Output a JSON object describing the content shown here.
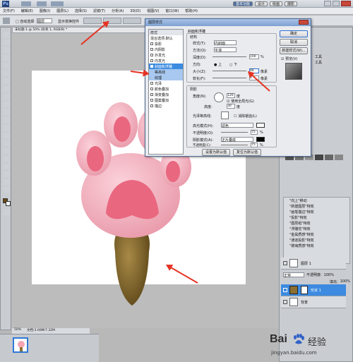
{
  "app": {
    "logo": "Ps",
    "right_buttons": [
      "基本功能",
      "设计",
      "绘画",
      "摄影"
    ]
  },
  "menu": [
    "文件(F)",
    "编辑(E)",
    "图像(I)",
    "图层(L)",
    "选择(S)",
    "滤镜(T)",
    "分析(A)",
    "3D(D)",
    "视图(V)",
    "窗口(W)",
    "帮助(H)"
  ],
  "options": {
    "label": "□ 自动选择",
    "select": "图层",
    "btn1": "显示变换控件"
  },
  "doc": {
    "tab": "未标题-1 @ 50% (形状 1, RGB/8) *",
    "status": "50%",
    "status_doc": "文档:3.00M/7.32M"
  },
  "dialog": {
    "title": "图层样式",
    "styles": [
      "样式",
      "混合选项:默认",
      "投影",
      "内阴影",
      "外发光",
      "内发光",
      "斜面和浮雕",
      "等高线",
      "纹理",
      "光泽",
      "颜色叠加",
      "渐变叠加",
      "图案叠加",
      "描边"
    ],
    "section": "斜面和浮雕",
    "structure": "结构",
    "style_label": "样式(T):",
    "style_val": "内斜面",
    "technique_label": "方法(Q):",
    "technique_val": "平滑",
    "depth_label": "深度(D):",
    "depth_val": "100",
    "depth_unit": "%",
    "dir_label": "方向:",
    "dir_up": "上",
    "dir_down": "下",
    "size_label": "大小(Z):",
    "size_val": "46",
    "size_unit": "像素",
    "soften_label": "软化(F):",
    "soften_val": "0",
    "soften_unit": "像素",
    "shading": "阴影",
    "angle_label": "角度(N):",
    "angle_val": "120",
    "angle_unit": "度",
    "global_light": "使用全局光(G)",
    "altitude_label": "高度:",
    "altitude_val": "30",
    "altitude_unit": "度",
    "gloss_label": "光泽等高线:",
    "antialias": "消除锯齿(L)",
    "highlight_label": "高光模式(H):",
    "highlight_val": "滤色",
    "h_opacity_label": "不透明度(O):",
    "h_opacity_val": "75",
    "h_opacity_unit": "%",
    "shadow_label": "阴影模式(A):",
    "shadow_val": "正片叠底",
    "s_opacity_label": "不透明度(C):",
    "s_opacity_val": "75",
    "s_opacity_unit": "%",
    "btn_default": "设置为默认值",
    "btn_reset": "复位为默认值",
    "ok": "确定",
    "cancel": "取消",
    "new_style": "新建样式(W)...",
    "preview": "预览(V)"
  },
  "right_panel": {
    "labels": [
      "工具",
      "工具"
    ],
    "actions": [
      "\"向上\"移动",
      "\"新建图层\"特效",
      "\"画笔描边\"特效",
      "\"投影\"特效",
      "\"图层组\"特效",
      "\"浮雕花\"特效",
      "\"金属质感\"特效",
      "\"通道投影\"特效",
      "\"玻璃质感\"特效"
    ]
  },
  "layers": {
    "blend": "正常",
    "opacity_label": "不透明度:",
    "opacity": "100%",
    "fill_label": "填充:",
    "fill": "100%",
    "items": [
      "图层 1",
      "形状 1",
      "背景"
    ]
  },
  "watermark": {
    "brand": "Bai",
    "suffix": "经验",
    "url": "jingyan.baidu.com"
  },
  "colors": {
    "paw": "#f6a5b4",
    "pad": "#e9677f",
    "stick": "#8b6f32",
    "accent": "#e53323"
  }
}
